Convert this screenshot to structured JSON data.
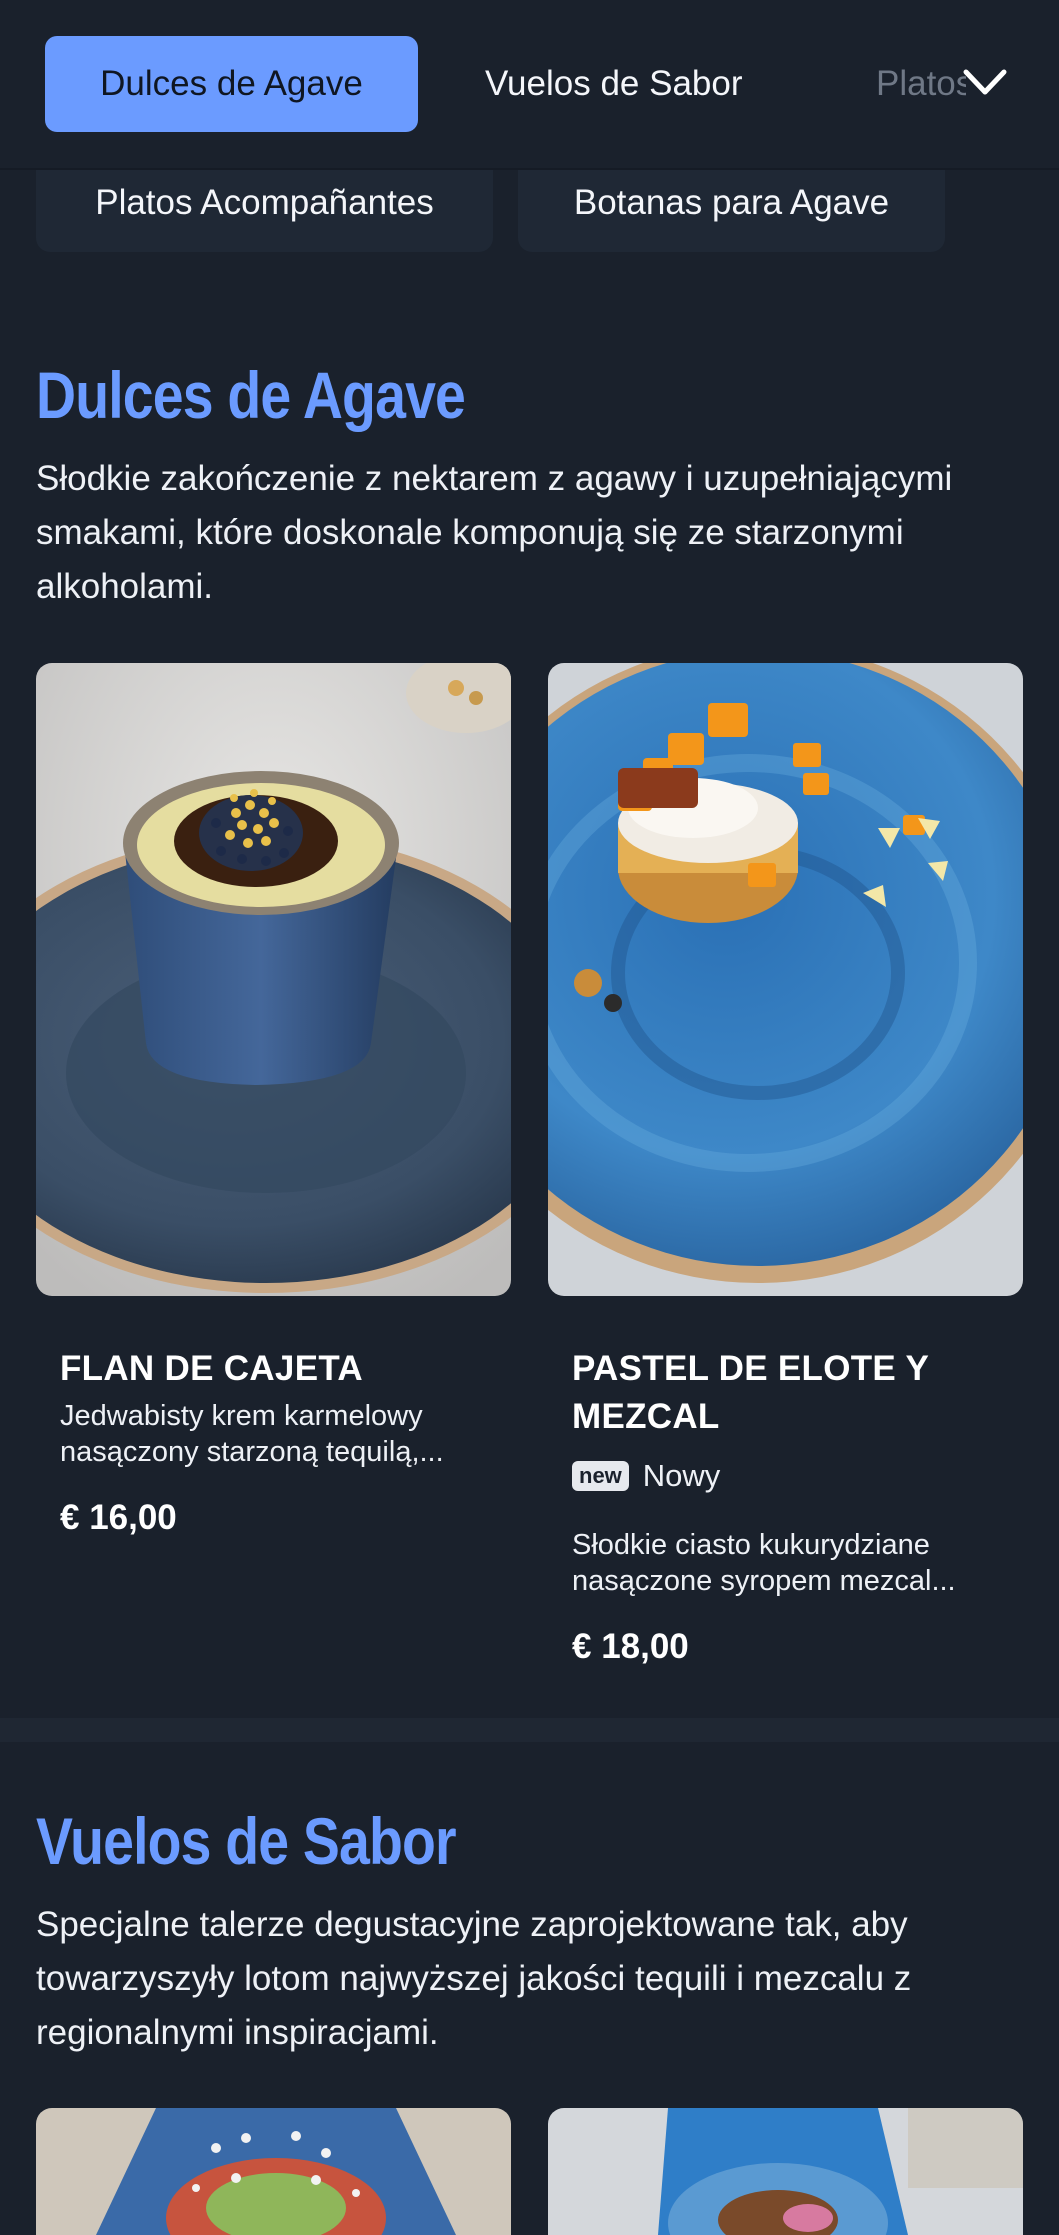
{
  "nav": {
    "tabs": [
      {
        "label": "Dulces de Agave",
        "active": true
      },
      {
        "label": "Vuelos de Sabor",
        "active": false
      },
      {
        "label": "Platos Acompañantes",
        "active": false
      }
    ],
    "chips": [
      {
        "label": "Platos Acompañantes"
      },
      {
        "label": "Botanas para Agave"
      }
    ],
    "expand_icon": "chevron-down-icon"
  },
  "sections": [
    {
      "title": "Dulces de Agave",
      "description": "Słodkie zakończenie z nektarem z agawy i uzupełniającymi smakami, które doskonale komponują się ze starzonymi alkoholami.",
      "items": [
        {
          "name": "FLAN DE CAJETA",
          "description": "Jedwabisty krem karmelowy nasączony starzoną tequilą,...",
          "price": "€ 16,00"
        },
        {
          "name": "PASTEL DE ELOTE Y MEZCAL",
          "badge": "new",
          "badge_label": "Nowy",
          "description": "Słodkie ciasto kukurydziane nasączone syropem mezcal...",
          "price": "€ 18,00"
        }
      ]
    },
    {
      "title": "Vuelos de Sabor",
      "description": "Specjalne talerze degustacyjne zaprojektowane tak, aby towarzyszyły lotom najwyższej jakości tequili i mezcalu z regionalnymi inspiracjami."
    }
  ],
  "colors": {
    "background": "#1a212c",
    "accent": "#6b9bff",
    "chip": "#1f2835"
  }
}
